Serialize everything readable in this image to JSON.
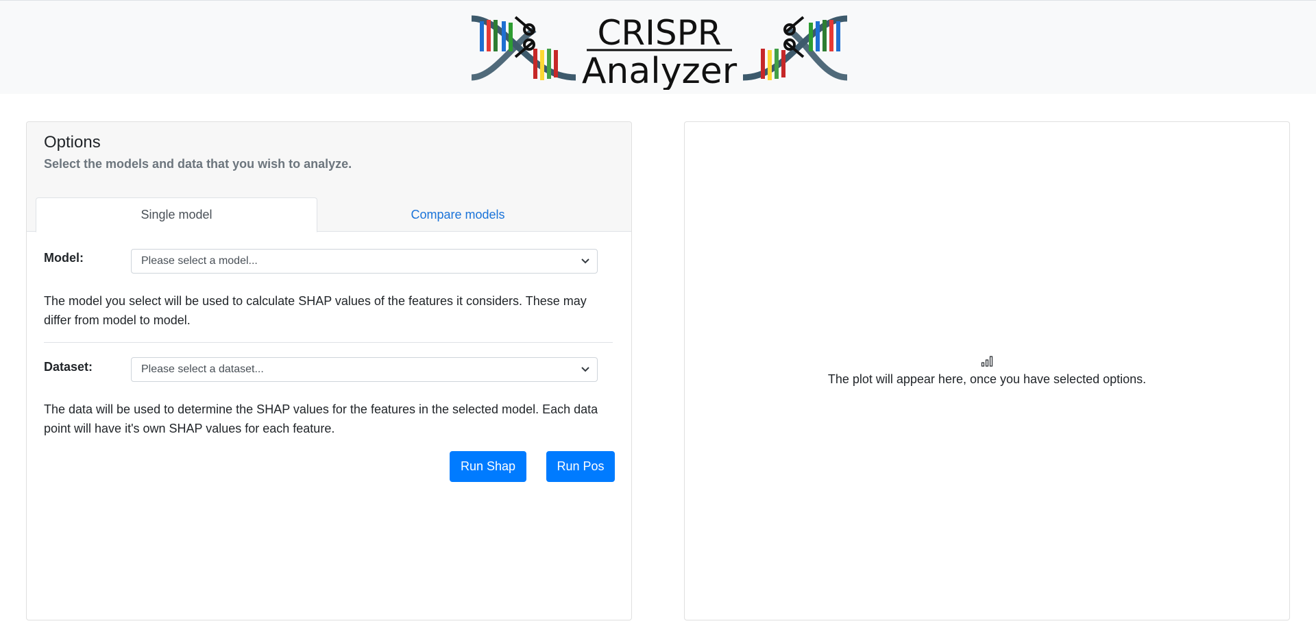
{
  "header": {
    "logo_line1": "CRISPR",
    "logo_line2": "Analyzer"
  },
  "options": {
    "title": "Options",
    "subtitle": "Select the models and data that you wish to analyze.",
    "tabs": [
      {
        "label": "Single model",
        "active": true
      },
      {
        "label": "Compare models",
        "active": false
      }
    ],
    "model": {
      "label": "Model:",
      "placeholder": "Please select a model...",
      "help": "The model you select will be used to calculate SHAP values of the features it considers. These may differ from model to model."
    },
    "dataset": {
      "label": "Dataset:",
      "placeholder": "Please select a dataset...",
      "help": "The data will be used to determine the SHAP values for the features in the selected model. Each data point will have it's own SHAP values for each feature."
    },
    "buttons": {
      "run_shap": "Run Shap",
      "run_pos": "Run Pos"
    }
  },
  "plot": {
    "icon": "bar-chart-icon",
    "placeholder": "The plot will appear here, once you have selected options."
  },
  "colors": {
    "primary": "#007bff",
    "link": "#1a73d9",
    "header_bg": "#f8f9fa",
    "dna_backbone": "#3d5a6c"
  }
}
